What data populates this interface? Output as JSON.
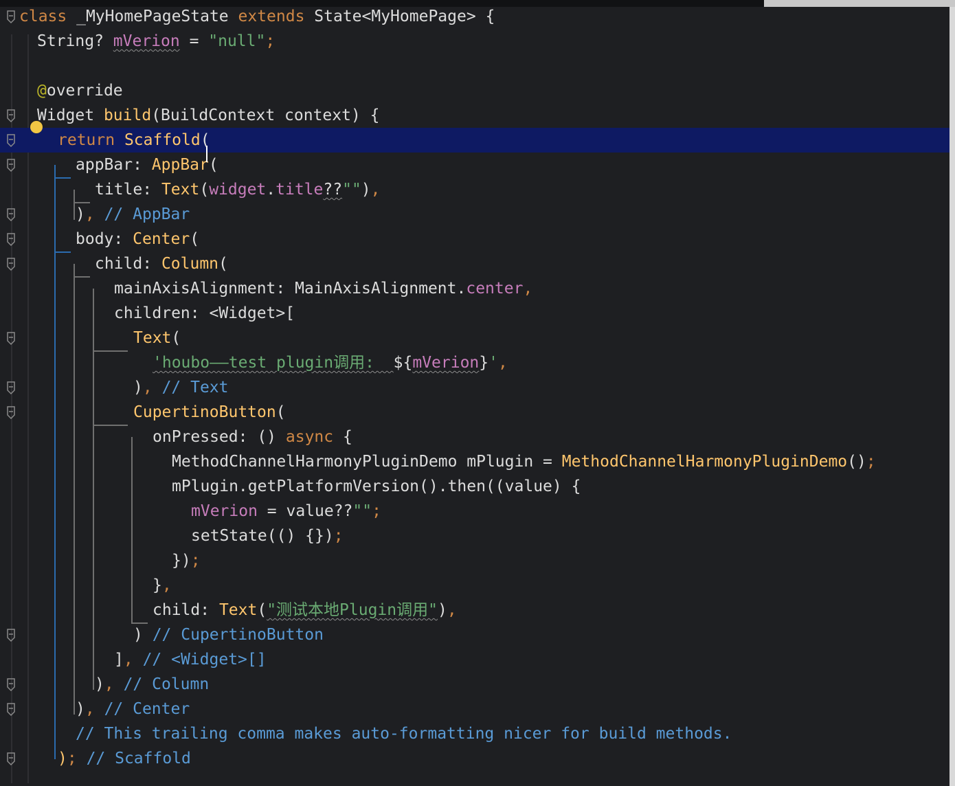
{
  "editor": {
    "language": "dart",
    "current_line_index": 5,
    "lines": [
      {
        "tokens": [
          [
            "kw",
            "class"
          ],
          [
            "ty",
            " _MyHomePageState "
          ],
          [
            "kw",
            "extends"
          ],
          [
            "ty",
            " State<MyHomePage> {"
          ]
        ]
      },
      {
        "tokens": [
          [
            "ty",
            "String? "
          ],
          [
            "fld",
            "mVerion"
          ],
          [
            "ty",
            " = "
          ],
          [
            "str",
            "\"null\""
          ],
          [
            "orange-punc",
            ";"
          ]
        ]
      },
      {
        "tokens": []
      },
      {
        "tokens": [
          [
            "an",
            "@"
          ],
          [
            "ty",
            "override"
          ]
        ]
      },
      {
        "tokens": [
          [
            "ty",
            "Widget "
          ],
          [
            "fn",
            "build"
          ],
          [
            "ty",
            "(BuildContext context) {"
          ]
        ]
      },
      {
        "tokens": [
          [
            "kw",
            "return "
          ],
          [
            "fn",
            "Scaffold"
          ],
          [
            "ty",
            "("
          ]
        ]
      },
      {
        "tokens": [
          [
            "ty",
            "appBar: "
          ],
          [
            "fn",
            "AppBar"
          ],
          [
            "ty",
            "("
          ]
        ]
      },
      {
        "tokens": [
          [
            "ty",
            "title: "
          ],
          [
            "fn",
            "Text"
          ],
          [
            "ty",
            "("
          ],
          [
            "fld",
            "widget"
          ],
          [
            "ty",
            "."
          ],
          [
            "fld",
            "title"
          ],
          [
            "ty",
            "??"
          ],
          [
            "str",
            "\"\""
          ],
          [
            "ty",
            ")"
          ],
          [
            "orange-punc",
            ","
          ]
        ]
      },
      {
        "tokens": [
          [
            "ty",
            ")"
          ],
          [
            "orange-punc",
            ","
          ],
          [
            "cm",
            " // AppBar"
          ]
        ]
      },
      {
        "tokens": [
          [
            "ty",
            "body: "
          ],
          [
            "fn",
            "Center"
          ],
          [
            "ty",
            "("
          ]
        ]
      },
      {
        "tokens": [
          [
            "ty",
            "child: "
          ],
          [
            "fn",
            "Column"
          ],
          [
            "ty",
            "("
          ]
        ]
      },
      {
        "tokens": [
          [
            "ty",
            "mainAxisAlignment: MainAxisAlignment."
          ],
          [
            "fld",
            "center"
          ],
          [
            "orange-punc",
            ","
          ]
        ]
      },
      {
        "tokens": [
          [
            "ty",
            "children: <Widget>["
          ]
        ]
      },
      {
        "tokens": [
          [
            "fn",
            "Text"
          ],
          [
            "ty",
            "("
          ]
        ]
      },
      {
        "tokens": [
          [
            "str",
            "'houbo——test plugin调用:  "
          ],
          [
            "ty",
            "${"
          ],
          [
            "fld",
            "mVerion"
          ],
          [
            "ty",
            "}"
          ],
          [
            "str",
            "'"
          ],
          [
            "orange-punc",
            ","
          ]
        ]
      },
      {
        "tokens": [
          [
            "ty",
            ")"
          ],
          [
            "orange-punc",
            ","
          ],
          [
            "cm",
            " // Text"
          ]
        ]
      },
      {
        "tokens": [
          [
            "fn",
            "CupertinoButton"
          ],
          [
            "ty",
            "("
          ]
        ]
      },
      {
        "tokens": [
          [
            "ty",
            "onPressed: () "
          ],
          [
            "kw",
            "async"
          ],
          [
            "ty",
            " {"
          ]
        ]
      },
      {
        "tokens": [
          [
            "ty",
            "MethodChannelHarmonyPluginDemo mPlugin = "
          ],
          [
            "fn",
            "MethodChannelHarmonyPluginDemo"
          ],
          [
            "ty",
            "()"
          ],
          [
            "orange-punc",
            ";"
          ]
        ]
      },
      {
        "tokens": [
          [
            "ty",
            "mPlugin.getPlatformVersion().then((value) {"
          ]
        ]
      },
      {
        "tokens": [
          [
            "fld",
            "mVerion"
          ],
          [
            "ty",
            " = value??"
          ],
          [
            "str",
            "\"\""
          ],
          [
            "orange-punc",
            ";"
          ]
        ]
      },
      {
        "tokens": [
          [
            "ty",
            "setState(() {})"
          ],
          [
            "orange-punc",
            ";"
          ]
        ]
      },
      {
        "tokens": [
          [
            "ty",
            "})"
          ],
          [
            "orange-punc",
            ";"
          ]
        ]
      },
      {
        "tokens": [
          [
            "ty",
            "}"
          ],
          [
            "orange-punc",
            ","
          ]
        ]
      },
      {
        "tokens": [
          [
            "ty",
            "child: "
          ],
          [
            "fn",
            "Text"
          ],
          [
            "ty",
            "("
          ],
          [
            "str",
            "\"测试本地Plugin调用\""
          ],
          [
            "ty",
            ")"
          ],
          [
            "orange-punc",
            ","
          ]
        ]
      },
      {
        "tokens": [
          [
            "ty",
            ") "
          ],
          [
            "cm",
            "// CupertinoButton"
          ]
        ]
      },
      {
        "tokens": [
          [
            "ty",
            "]"
          ],
          [
            "orange-punc",
            ","
          ],
          [
            "cm",
            " // <Widget>[]"
          ]
        ]
      },
      {
        "tokens": [
          [
            "ty",
            ")"
          ],
          [
            "orange-punc",
            ","
          ],
          [
            "cm",
            " // Column"
          ]
        ]
      },
      {
        "tokens": [
          [
            "ty",
            ")"
          ],
          [
            "orange-punc",
            ","
          ],
          [
            "cm",
            " // Center"
          ]
        ]
      },
      {
        "tokens": [
          [
            "cm",
            "// This trailing comma makes auto-formatting nicer for build methods."
          ]
        ]
      },
      {
        "tokens": [
          [
            "fn",
            ")"
          ],
          [
            "orange-punc",
            ";"
          ],
          [
            "cm",
            " // Scaffold"
          ]
        ]
      }
    ]
  },
  "colors": {
    "background": "#1e1f22",
    "current_line": "#0e1a63",
    "keyword": "#d08846",
    "function": "#ffc66d",
    "field": "#c77dbb",
    "string": "#6aab73",
    "comment": "#5a9bd6",
    "annotation": "#bbb529"
  },
  "icons": {
    "lightbulb": "lightbulb-icon",
    "fold": "fold-marker-icon"
  }
}
